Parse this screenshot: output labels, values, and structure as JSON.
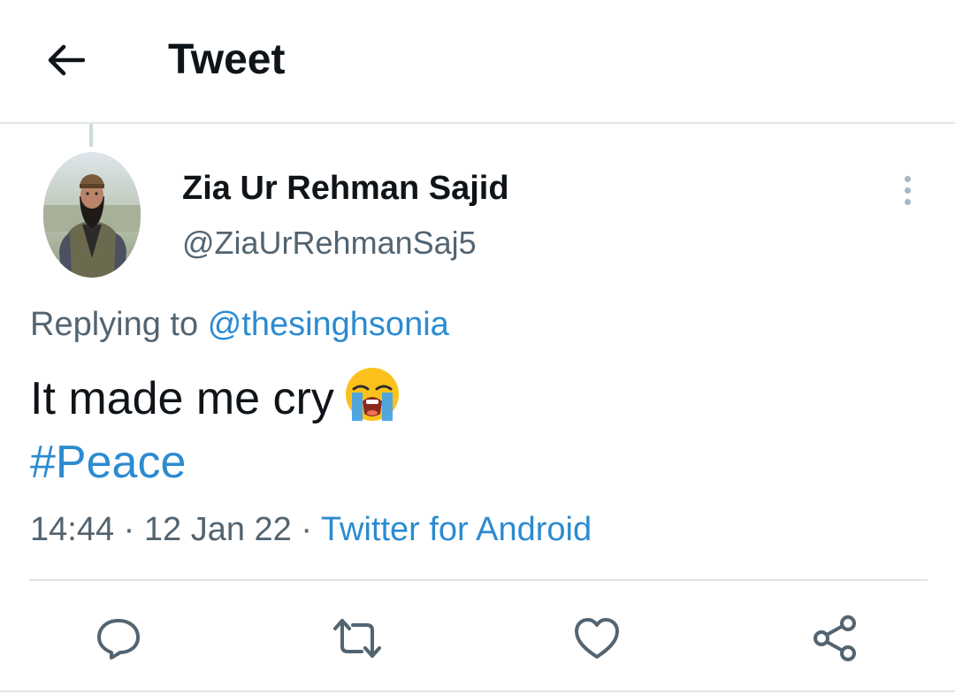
{
  "header": {
    "back_icon": "arrow-left-icon",
    "title": "Tweet"
  },
  "tweet": {
    "author": {
      "display_name": "Zia Ur Rehman Sajid",
      "handle": "@ZiaUrRehmanSaj5"
    },
    "more_icon": "more-vertical-icon",
    "replying_prefix": "Replying to",
    "replying_to": "@thesinghsonia",
    "text": "It made me cry",
    "emoji_icon": "loudly-crying-face-emoji",
    "hashtag": "#Peace",
    "time": "14:44",
    "separator": "·",
    "date": "12 Jan 22",
    "source": "Twitter for Android"
  },
  "actions": {
    "reply_icon": "comment-icon",
    "retweet_icon": "retweet-icon",
    "like_icon": "heart-icon",
    "share_icon": "share-icon"
  },
  "colors": {
    "text_primary": "#0f1419",
    "text_secondary": "#536471",
    "link": "#2c8bd0",
    "icon": "#536471",
    "divider": "#e1e5e8"
  }
}
